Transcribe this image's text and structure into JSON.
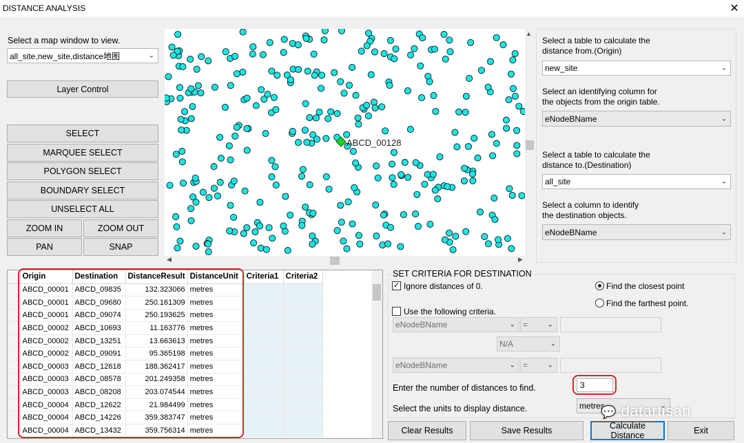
{
  "window": {
    "title": "DISTANCE ANALYSIS",
    "close_glyph": "✕"
  },
  "left": {
    "map_prompt": "Select a map window to view.",
    "map_select": "all_site,new_site,distance地图",
    "layer_control": "Layer Control",
    "tools": {
      "select": "SELECT",
      "marquee": "MARQUEE SELECT",
      "polygon": "POLYGON SELECT",
      "boundary": "BOUNDARY SELECT",
      "unselect": "UNSELECT ALL",
      "zoom_in": "ZOOM IN",
      "zoom_out": "ZOOM OUT",
      "pan": "PAN",
      "snap": "SNAP"
    }
  },
  "map": {
    "selected_label": "ABCD_00128",
    "point_color": "#19e5e5",
    "selected_color": "#22cc22"
  },
  "right": {
    "origin_table_label_1": "Select a table to calculate the",
    "origin_table_label_2": "distance from.(Origin)",
    "origin_table": "new_site",
    "origin_col_label_1": "Select an identifying column for",
    "origin_col_label_2": "the objects from the origin table.",
    "origin_col": "eNodeBName",
    "dest_table_label_1": "Select a table to calculate the",
    "dest_table_label_2": "distance to.(Destination)",
    "dest_table": "all_site",
    "dest_col_label_1": "Select a column to identify",
    "dest_col_label_2": "the destination objects.",
    "dest_col": "eNodeBName"
  },
  "results": {
    "columns": [
      "Origin",
      "Destination",
      "DistanceResult",
      "DistanceUnit",
      "Criteria1",
      "Criteria2"
    ],
    "rows": [
      [
        "ABCD_00001",
        "ABCD_09835",
        "132.323066",
        "metres"
      ],
      [
        "ABCD_00001",
        "ABCD_09680",
        "250.161309",
        "metres"
      ],
      [
        "ABCD_00001",
        "ABCD_09074",
        "250.193625",
        "metres"
      ],
      [
        "ABCD_00002",
        "ABCD_10693",
        "11.163776",
        "metres"
      ],
      [
        "ABCD_00002",
        "ABCD_13251",
        "13.663613",
        "metres"
      ],
      [
        "ABCD_00002",
        "ABCD_09091",
        "95.365198",
        "metres"
      ],
      [
        "ABCD_00003",
        "ABCD_12618",
        "188.362417",
        "metres"
      ],
      [
        "ABCD_00003",
        "ABCD_08578",
        "201.249358",
        "metres"
      ],
      [
        "ABCD_00003",
        "ABCD_08208",
        "203.074544",
        "metres"
      ],
      [
        "ABCD_00004",
        "ABCD_12622",
        "21.984499",
        "metres"
      ],
      [
        "ABCD_00004",
        "ABCD_14226",
        "359.383747",
        "metres"
      ],
      [
        "ABCD_00004",
        "ABCD_13432",
        "359.756314",
        "metres"
      ]
    ]
  },
  "criteria": {
    "heading": "SET CRITERIA FOR DESTINATION",
    "ignore_zero": "Ignore distances of 0.",
    "ignore_zero_checked": true,
    "use_criteria": "Use the following criteria.",
    "use_criteria_checked": false,
    "closest": "Find the closest point",
    "farthest": "Find the farthest point.",
    "closest_selected": true,
    "crit1_col": "eNodeBName",
    "crit1_op": "=",
    "logic": "N/A",
    "crit2_col": "eNodeBName",
    "crit2_op": "=",
    "num_label": "Enter the number of distances to find.",
    "num_value": "3",
    "units_label": "Select the units to display distance.",
    "units_value": "metres"
  },
  "buttons": {
    "clear": "Clear Results",
    "save": "Save Results",
    "calculate": "Calculate Distance",
    "exit": "Exit"
  },
  "watermark": "datartisan"
}
